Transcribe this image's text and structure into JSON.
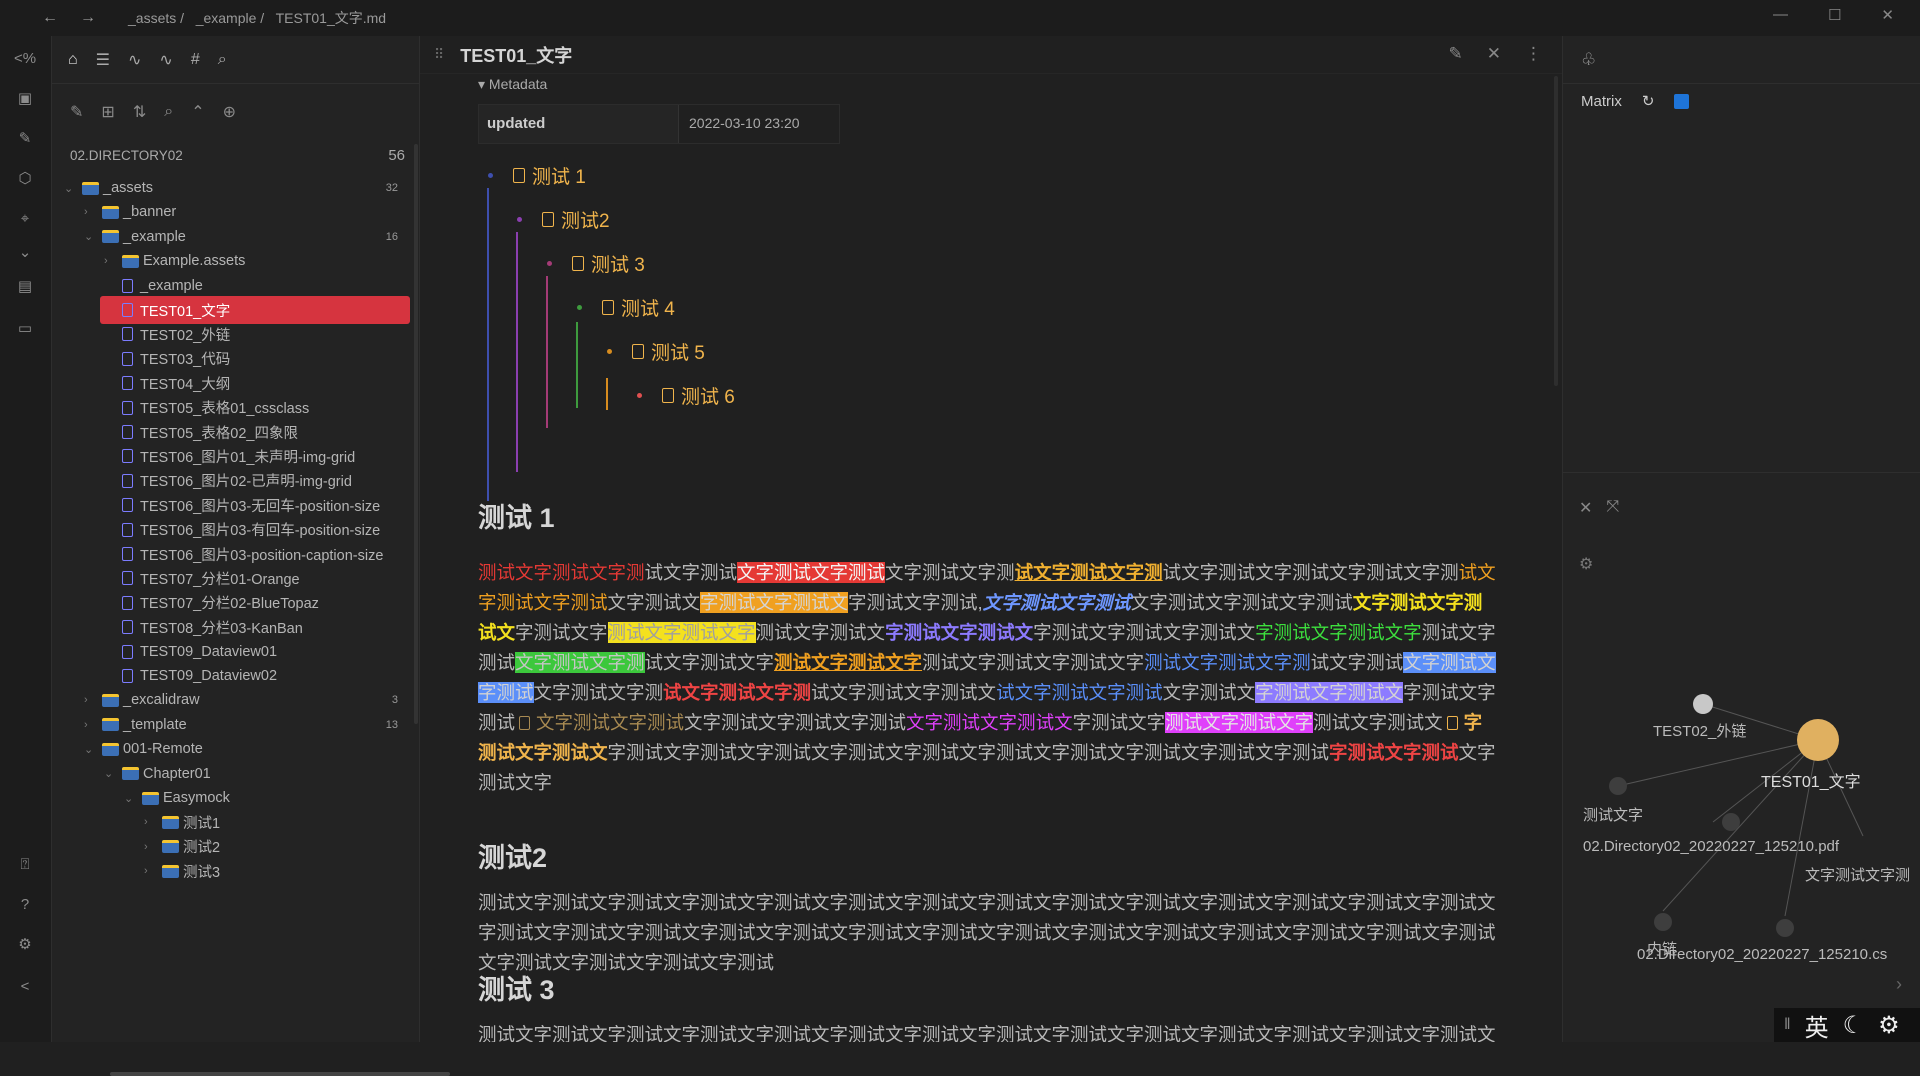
{
  "titlebar": {
    "breadcrumb": "_assets /   _example /   TEST01_文字.md",
    "back_icon": "←",
    "forward_icon": "→",
    "minimize_icon": "—",
    "maximize_icon": "☐",
    "close_icon": "✕"
  },
  "ribbon": {
    "icons": [
      "<%",
      "▣",
      "✎",
      "⬡",
      "⌖",
      "⌄",
      "▤",
      "▭",
      "⍰",
      "?",
      "⚙",
      "<"
    ]
  },
  "sidebar": {
    "tab_icons": [
      "⌂",
      "☰",
      "∿",
      "∿",
      "#",
      "⌕"
    ],
    "action_icons": [
      "✎",
      "⊞",
      "⇅",
      "⌕",
      "⌃",
      "⊕"
    ],
    "vault_name": "02.DIRECTORY02",
    "vault_count": "56",
    "tree": [
      {
        "label": "_assets",
        "type": "folder",
        "depth": 0,
        "open": true,
        "count": "32"
      },
      {
        "label": "_banner",
        "type": "folder",
        "depth": 1,
        "open": false,
        "count": ""
      },
      {
        "label": "_example",
        "type": "folder",
        "depth": 1,
        "open": true,
        "count": "16"
      },
      {
        "label": "Example.assets",
        "type": "folder",
        "depth": 2,
        "open": false,
        "count": ""
      },
      {
        "label": "_example",
        "type": "file",
        "depth": 2,
        "count": ""
      },
      {
        "label": "TEST01_文字",
        "type": "file",
        "depth": 2,
        "count": "",
        "active": true
      },
      {
        "label": "TEST02_外链",
        "type": "file",
        "depth": 2,
        "count": ""
      },
      {
        "label": "TEST03_代码",
        "type": "file",
        "depth": 2,
        "count": ""
      },
      {
        "label": "TEST04_大纲",
        "type": "file",
        "depth": 2,
        "count": ""
      },
      {
        "label": "TEST05_表格01_cssclass",
        "type": "file",
        "depth": 2,
        "count": ""
      },
      {
        "label": "TEST05_表格02_四象限",
        "type": "file",
        "depth": 2,
        "count": ""
      },
      {
        "label": "TEST06_图片01_未声明-img-grid",
        "type": "file",
        "depth": 2,
        "count": ""
      },
      {
        "label": "TEST06_图片02-已声明-img-grid",
        "type": "file",
        "depth": 2,
        "count": ""
      },
      {
        "label": "TEST06_图片03-无回车-position-size",
        "type": "file",
        "depth": 2,
        "count": ""
      },
      {
        "label": "TEST06_图片03-有回车-position-size",
        "type": "file",
        "depth": 2,
        "count": ""
      },
      {
        "label": "TEST06_图片03-position-caption-size",
        "type": "file",
        "depth": 2,
        "count": ""
      },
      {
        "label": "TEST07_分栏01-Orange",
        "type": "file",
        "depth": 2,
        "count": ""
      },
      {
        "label": "TEST07_分栏02-BlueTopaz",
        "type": "file",
        "depth": 2,
        "count": ""
      },
      {
        "label": "TEST08_分栏03-KanBan",
        "type": "file",
        "depth": 2,
        "count": ""
      },
      {
        "label": "TEST09_Dataview01",
        "type": "file",
        "depth": 2,
        "count": ""
      },
      {
        "label": "TEST09_Dataview02",
        "type": "file",
        "depth": 2,
        "count": ""
      },
      {
        "label": "_excalidraw",
        "type": "folder",
        "depth": 1,
        "open": false,
        "count": "3"
      },
      {
        "label": "_template",
        "type": "folder",
        "depth": 1,
        "open": false,
        "count": "13"
      },
      {
        "label": "001-Remote",
        "type": "folder",
        "depth": 1,
        "open": true,
        "count": ""
      },
      {
        "label": "Chapter01",
        "type": "folder",
        "depth": 2,
        "open": true,
        "count": ""
      },
      {
        "label": "Easymock",
        "type": "folder",
        "depth": 3,
        "open": true,
        "count": ""
      },
      {
        "label": "测试1",
        "type": "folder",
        "depth": 4,
        "open": false,
        "count": ""
      },
      {
        "label": "测试2",
        "type": "folder",
        "depth": 4,
        "open": false,
        "count": ""
      },
      {
        "label": "测试3",
        "type": "folder",
        "depth": 4,
        "open": false,
        "count": ""
      }
    ]
  },
  "editor": {
    "tab_title": "TEST01_文字",
    "drag_icon": "⠿",
    "edit_icon": "✎",
    "close_icon": "✕",
    "more_icon": "⋮",
    "metadata_toggle": "▾ Metadata",
    "meta_key": "updated",
    "meta_value": "2022-03-10 23:20",
    "nested_list": [
      "测试 1",
      "测试2",
      "测试 3",
      "测试 4",
      "测试 5",
      "测试 6"
    ],
    "h_1": "测试 1",
    "h_2": "测试2",
    "h_3": "测试 3",
    "para2": "测试文字测试文字测试文字测试文字测试文字测试文字测试文字测试文字测试文字测试文字测试文字测试文字测试文字测试文字测试文字测试文字测试文字测试文字测试文字测试文字测试文字测试文字测试文字测试文字测试文字测试文字测试文字测试文字测试文字测试文字测试文字测试",
    "para3": "测试文字测试文字测试文字测试文字测试文字测试文字测试文字测试文字测试文字测试文字测试文字测试文字测试文字测试文字测试文字测试文字测试文字测试文字测试文字测试文字测试"
  },
  "right_panel": {
    "header_icon": "♧",
    "matrix_label": "Matrix",
    "refresh_icon": "↻",
    "graph_tool_icons": [
      "✕",
      "⤧"
    ],
    "graph_gear": "⚙",
    "graph_nodes": [
      "TEST02_外链",
      "TEST01_文字",
      "测试文字",
      "02.Directory02_20220227_125210.pdf",
      "文字测试文字测",
      "内链",
      "02.Directory02_20220227_125210.cs"
    ],
    "collapse_icon": "›"
  },
  "statusbar": {
    "sep": "‖",
    "ime": "英",
    "moon": "☾",
    "gear": "⚙"
  },
  "colors": {
    "active_file": "#d6343f",
    "accent_blue": "#1e74d8",
    "list_orange": "#f0b44c",
    "node_orange": "#e0b060"
  }
}
